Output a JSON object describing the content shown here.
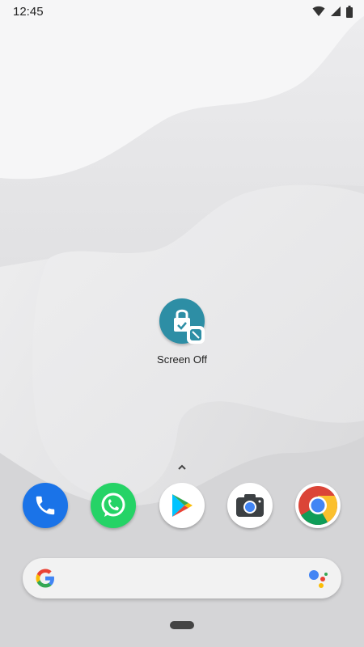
{
  "status_bar": {
    "time": "12:45",
    "icons": [
      "wifi-icon",
      "cellular-signal-icon",
      "battery-icon"
    ]
  },
  "home": {
    "apps": [
      {
        "label": "Screen Off",
        "icon": "screen-off-lock-icon",
        "color": "#2d8ea5"
      }
    ]
  },
  "app_drawer": {
    "icon": "chevron-up-icon"
  },
  "dock": {
    "apps": [
      {
        "icon": "phone-icon",
        "color": "#1a73e8"
      },
      {
        "icon": "whatsapp-icon",
        "color": "#25d366"
      },
      {
        "icon": "play-store-icon",
        "color": "#ffffff"
      },
      {
        "icon": "camera-icon",
        "color": "#ffffff"
      },
      {
        "icon": "chrome-icon",
        "color": "#ffffff"
      }
    ]
  },
  "search_bar": {
    "left_icon": "google-g-icon",
    "right_icon": "google-assistant-icon"
  },
  "navigation": {
    "handle": "home-gesture-handle"
  }
}
